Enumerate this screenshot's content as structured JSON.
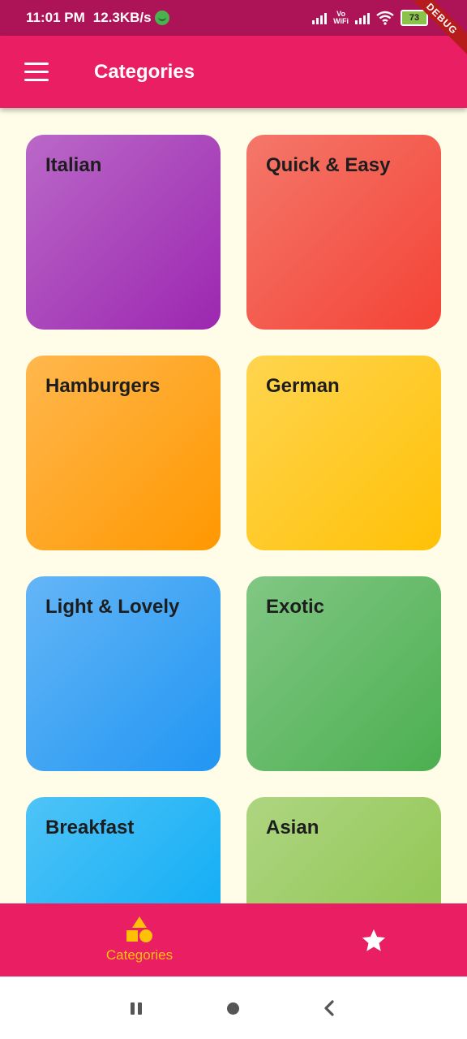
{
  "status_bar": {
    "time": "11:01 PM",
    "net_speed": "12.3KB/s",
    "vowifi_top": "Vo",
    "vowifi_bottom": "WiFi",
    "battery": "73"
  },
  "debug_banner": "DEBUG",
  "app_bar": {
    "title": "Categories",
    "menu_icon": "hamburger-menu-icon"
  },
  "categories": [
    {
      "title": "Italian",
      "color_from": "#BA68C8",
      "color_to": "#9C27B0"
    },
    {
      "title": "Quick & Easy",
      "color_from": "#F4776A",
      "color_to": "#F44336"
    },
    {
      "title": "Hamburgers",
      "color_from": "#FFB74D",
      "color_to": "#FF9800"
    },
    {
      "title": "German",
      "color_from": "#FFD54F",
      "color_to": "#FFC107"
    },
    {
      "title": "Light & Lovely",
      "color_from": "#64B5F6",
      "color_to": "#2196F3"
    },
    {
      "title": "Exotic",
      "color_from": "#81C784",
      "color_to": "#4CAF50"
    },
    {
      "title": "Breakfast",
      "color_from": "#4FC3F7",
      "color_to": "#03A9F4"
    },
    {
      "title": "Asian",
      "color_from": "#AED581",
      "color_to": "#8BC34A"
    }
  ],
  "bottom_nav": {
    "categories_label": "Categories",
    "categories_icon": "shapes-icon",
    "favorites_icon": "star-icon",
    "selected": "Categories"
  },
  "colors": {
    "primary": "#E91E63",
    "accent": "#FFC107",
    "background": "#FFFDE7"
  }
}
